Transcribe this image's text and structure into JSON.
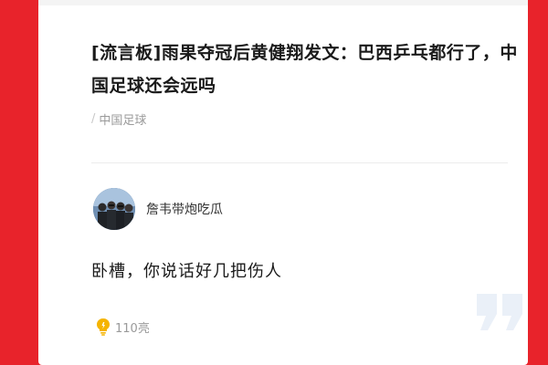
{
  "post": {
    "title": "[流言板]雨果夺冠后黄健翔发文：巴西乒乓都行了，中国足球还会远吗",
    "category_separator": "/",
    "category": "中国足球"
  },
  "comment": {
    "username": "詹韦带炮吃瓜",
    "text": "卧槽，你说话好几把伤人",
    "likes": "110亮"
  },
  "icons": {
    "avatar": "avatar-photo",
    "like": "lightbulb-icon",
    "quote": "quote-mark-icon"
  },
  "colors": {
    "background": "#e8232b",
    "card": "#ffffff",
    "like_icon": "#f5b400",
    "quote_mark": "#eaf0f8"
  }
}
